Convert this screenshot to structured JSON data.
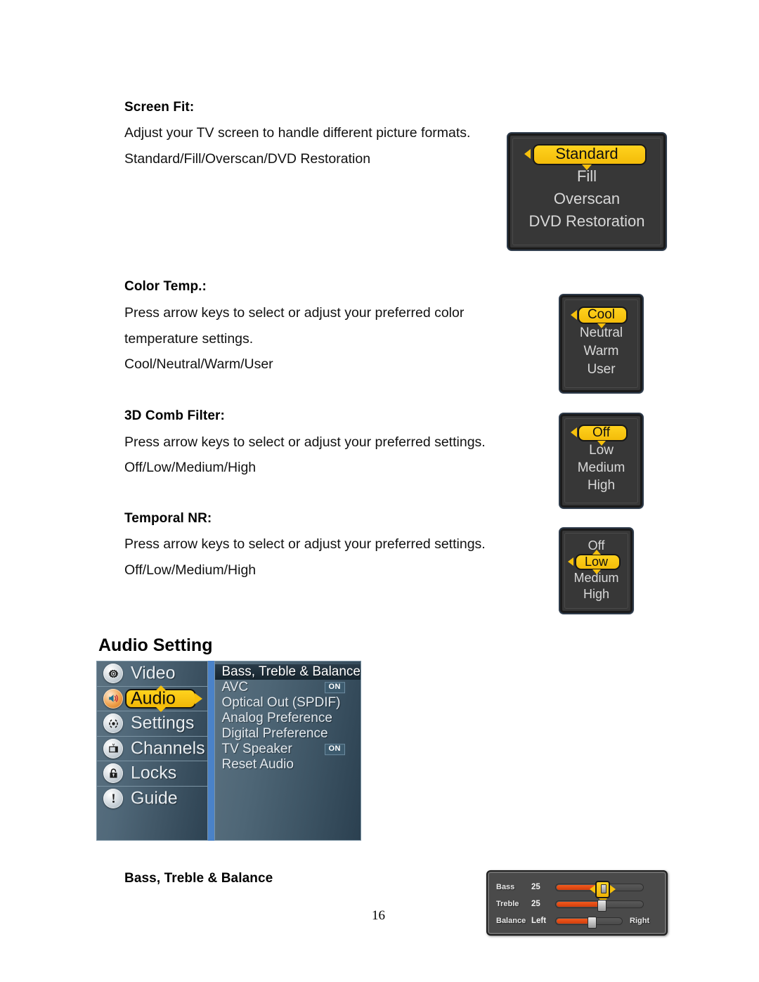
{
  "page": {
    "number": "16"
  },
  "sections": [
    {
      "title": "Screen Fit:",
      "lines": [
        "Adjust your TV screen to handle different picture formats.",
        "Standard/Fill/Overscan/DVD Restoration"
      ]
    },
    {
      "title": "Color Temp.:",
      "lines": [
        "Press arrow keys to select or adjust your preferred color",
        "temperature settings.",
        "Cool/Neutral/Warm/User"
      ]
    },
    {
      "title": "3D Comb Filter:",
      "lines": [
        "Press arrow keys to select or adjust your preferred settings.",
        "Off/Low/Medium/High"
      ]
    },
    {
      "title": "Temporal NR:",
      "lines": [
        "Press arrow keys to select or adjust your preferred settings.",
        "Off/Low/Medium/High"
      ]
    }
  ],
  "osd": {
    "screen_fit": {
      "items": [
        "Standard",
        "Fill",
        "Overscan",
        "DVD Restoration"
      ],
      "selected_index": 0
    },
    "color_temp": {
      "items": [
        "Cool",
        "Neutral",
        "Warm",
        "User"
      ],
      "selected_index": 0
    },
    "comb_filter": {
      "items": [
        "Off",
        "Low",
        "Medium",
        "High"
      ],
      "selected_index": 0
    },
    "temporal_nr": {
      "items": [
        "Off",
        "Low",
        "Medium",
        "High"
      ],
      "selected_index": 1
    }
  },
  "audio_setting": {
    "heading": "Audio Setting",
    "left_menu": [
      {
        "label": "Video",
        "icon": "gear-icon",
        "active": false
      },
      {
        "label": "Audio",
        "icon": "speaker-icon",
        "active": true
      },
      {
        "label": "Settings",
        "icon": "settings-icon",
        "active": false
      },
      {
        "label": "Channels",
        "icon": "tv-icon",
        "active": false
      },
      {
        "label": "Locks",
        "icon": "lock-icon",
        "active": false
      },
      {
        "label": "Guide",
        "icon": "exclamation-icon",
        "active": false
      }
    ],
    "right_menu": [
      {
        "label": "Bass, Treble & Balance",
        "badge": "",
        "selected": true
      },
      {
        "label": "AVC",
        "badge": "ON",
        "selected": false
      },
      {
        "label": "Optical Out (SPDIF)",
        "badge": "",
        "selected": false
      },
      {
        "label": "Analog Preference",
        "badge": "",
        "selected": false
      },
      {
        "label": "Digital Preference",
        "badge": "",
        "selected": false
      },
      {
        "label": "TV Speaker",
        "badge": "ON",
        "selected": false
      },
      {
        "label": "Reset Audio",
        "badge": "",
        "selected": false
      }
    ]
  },
  "bass_treble": {
    "heading": "Bass, Treble & Balance",
    "rows": [
      {
        "label": "Bass",
        "value": "25",
        "fill_pct": 50,
        "right_label": "",
        "selected": true
      },
      {
        "label": "Treble",
        "value": "25",
        "fill_pct": 50,
        "right_label": "",
        "selected": false
      },
      {
        "label": "Balance",
        "value": "Left",
        "fill_pct": 50,
        "right_label": "Right",
        "selected": false
      }
    ]
  },
  "colors": {
    "highlight_yellow": "#f3bc09",
    "osd_dark": "#373737",
    "menu_slate": "#4e6676",
    "divider_blue": "#4a82c8",
    "slider_orange": "#e24a12"
  }
}
